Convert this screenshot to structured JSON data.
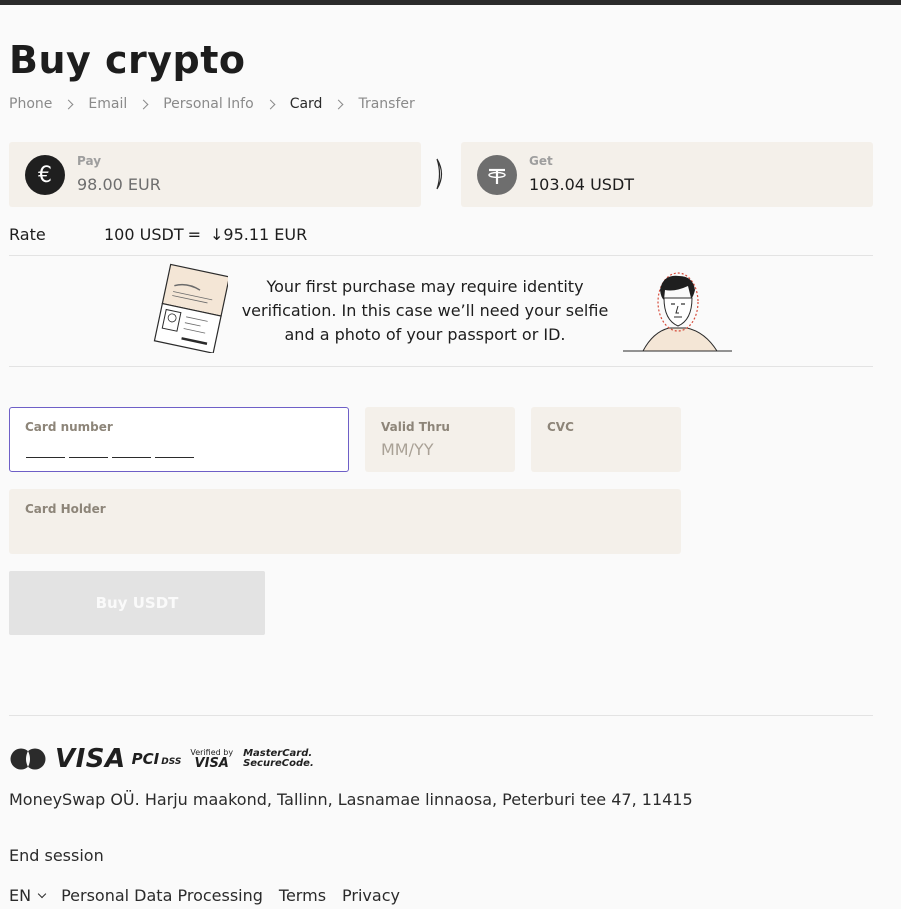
{
  "page": {
    "title": "Buy crypto"
  },
  "breadcrumb": [
    "Phone",
    "Email",
    "Personal Info",
    "Card",
    "Transfer"
  ],
  "breadcrumb_active": "Card",
  "pay": {
    "label": "Pay",
    "value": "98.00 EUR",
    "icon": "euro-icon"
  },
  "get": {
    "label": "Get",
    "value": "103.04 USDT",
    "icon": "tether-icon"
  },
  "rate": {
    "label": "Rate",
    "left": "100 USDT",
    "eq": "=",
    "right": "↓95.11 EUR"
  },
  "notice": "Your first purchase may require identity verification. In this case we’ll need your selfie and a photo of your passport or ID.",
  "form": {
    "card_number_label": "Card number",
    "valid_thru_label": "Valid Thru",
    "valid_thru_placeholder": "MM/YY",
    "cvc_label": "CVC",
    "card_holder_label": "Card Holder",
    "submit_label": "Buy USDT"
  },
  "footer": {
    "verified_by": "Verified by",
    "visa_small": "VISA",
    "securecode_1": "MasterCard.",
    "securecode_2": "SecureCode.",
    "visa": "VISA",
    "pci_1": "PCI",
    "pci_2": "DSS",
    "company": "MoneySwap OÜ. Harju maakond, Tallinn, Lasnamae linnaosa, Peterburi tee 47, 11415",
    "end_session": "End session",
    "lang": "EN",
    "links": [
      "Personal Data Processing",
      "Terms",
      "Privacy"
    ]
  },
  "colors": {
    "accent_border": "#6e5fc7",
    "field_bg": "#f4f0ea",
    "disabled_button": "#e3e3e3"
  }
}
